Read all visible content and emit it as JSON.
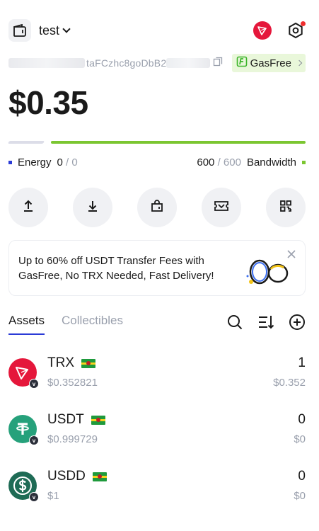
{
  "header": {
    "wallet_name": "test",
    "icons": [
      "wallet-icon",
      "chevron-down-icon",
      "tron-network-icon",
      "settings-icon"
    ]
  },
  "address": {
    "visible_fragment": "taFCzhc8goDbB2",
    "gasfree_label": "GasFree"
  },
  "balance": "$0.35",
  "resources": {
    "energy_label": "Energy",
    "energy_used": "0",
    "energy_sep": "/",
    "energy_total": "0",
    "bandwidth_used": "600",
    "bandwidth_sep": "/",
    "bandwidth_total": "600",
    "bandwidth_label": "Bandwidth",
    "energy_color": "#2b3bd6",
    "bandwidth_color": "#7bc631"
  },
  "actions": [
    {
      "name": "send",
      "icon": "upload-icon"
    },
    {
      "name": "receive",
      "icon": "download-icon"
    },
    {
      "name": "buy",
      "icon": "shopping-bag-icon"
    },
    {
      "name": "swap",
      "icon": "ticket-icon"
    },
    {
      "name": "more",
      "icon": "apps-icon"
    }
  ],
  "promo": {
    "line1": "Up to 60% off USDT Transfer Fees with",
    "line2": "GasFree, No TRX Needed, Fast Delivery!"
  },
  "tabs": {
    "assets": "Assets",
    "collectibles": "Collectibles"
  },
  "assets": [
    {
      "symbol": "TRX",
      "price": "$0.352821",
      "amount": "1",
      "value": "$0.352",
      "color": "#e5173b"
    },
    {
      "symbol": "USDT",
      "price": "$0.999729",
      "amount": "0",
      "value": "$0",
      "color": "#26a17b"
    },
    {
      "symbol": "USDD",
      "price": "$1",
      "amount": "0",
      "value": "$0",
      "color": "#1e6b55"
    }
  ]
}
